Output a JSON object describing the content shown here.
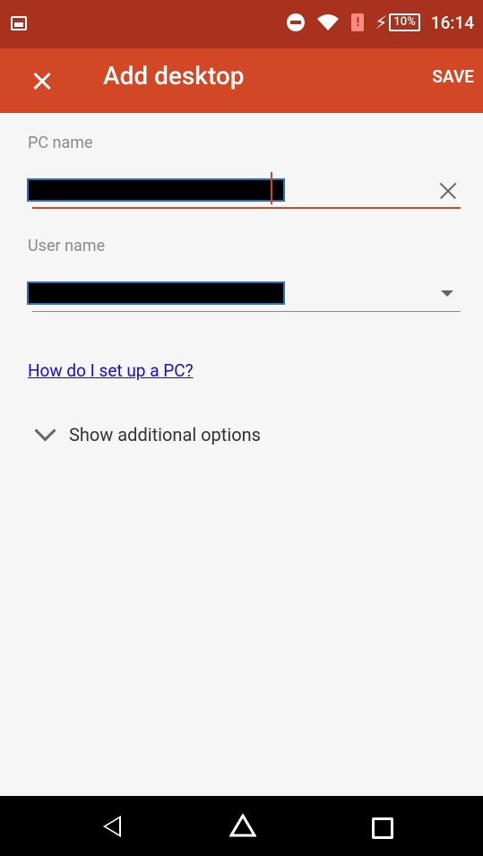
{
  "status_bar": {
    "battery_percent": "10%",
    "time": "16:14"
  },
  "app_bar": {
    "title": "Add desktop",
    "save_label": "SAVE"
  },
  "form": {
    "pc_name_label": "PC name",
    "user_name_label": "User name"
  },
  "help_link": "How do I set up a PC?",
  "additional_options": "Show additional options"
}
